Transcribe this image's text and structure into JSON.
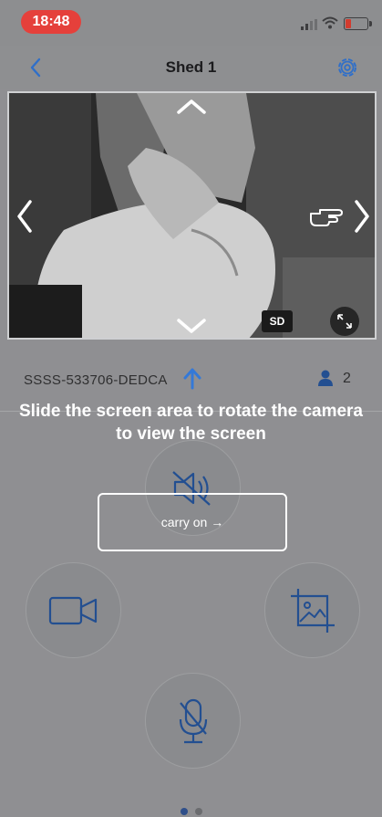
{
  "status_bar": {
    "time": "18:48"
  },
  "nav": {
    "title": "Shed 1",
    "back_icon": "chevron-left-icon",
    "settings_icon": "gear-icon"
  },
  "video": {
    "quality_badge": "SD"
  },
  "device": {
    "id": "SSSS-533706-DEDCA",
    "viewer_count": "2"
  },
  "guide": {
    "text": "Slide the screen area to rotate the camera to view the screen",
    "carry_on_label": "carry on →"
  },
  "controls": [
    "mute-speaker-icon",
    "record-video-icon",
    "snapshot-icon",
    "microphone-off-icon"
  ],
  "colors": {
    "accent": "#3479d8",
    "time_pill": "#e5403b"
  }
}
